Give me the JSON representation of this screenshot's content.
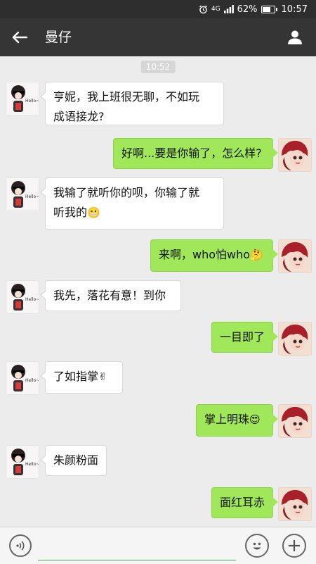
{
  "status_bar": {
    "network": "4G",
    "battery": "62%",
    "battery_level": 0.62,
    "time": "10:57"
  },
  "header": {
    "title": "曼仔"
  },
  "chat": {
    "timestamp": "10:52",
    "messages": [
      {
        "side": "left",
        "line1": "亨妮，我上班很无聊，不如玩",
        "line2": "成语接龙?"
      },
      {
        "side": "right",
        "text": "好啊...要是你输了，怎么样?"
      },
      {
        "side": "left",
        "line1": "我输了就听你的呗，你输了就",
        "line2": "听我的",
        "emoji": "😬"
      },
      {
        "side": "right",
        "text": "来啊，who怕who",
        "emoji": "🤔"
      },
      {
        "side": "left",
        "text": "我先，落花有意！到你"
      },
      {
        "side": "right",
        "text": "一目即了"
      },
      {
        "side": "left",
        "text": "了如指掌",
        "emoji": "✌"
      },
      {
        "side": "right",
        "text": "掌上明珠",
        "emoji": "😍"
      },
      {
        "side": "left",
        "text": "朱颜粉面"
      },
      {
        "side": "right",
        "text": "面红耳赤"
      }
    ]
  },
  "input_bar": {
    "placeholder": ""
  },
  "colors": {
    "title_bar": "#353535",
    "status_bar": "#2e2e2e",
    "bubble_out": "#a0e75a",
    "bubble_in": "#ffffff",
    "background": "#ececec"
  }
}
